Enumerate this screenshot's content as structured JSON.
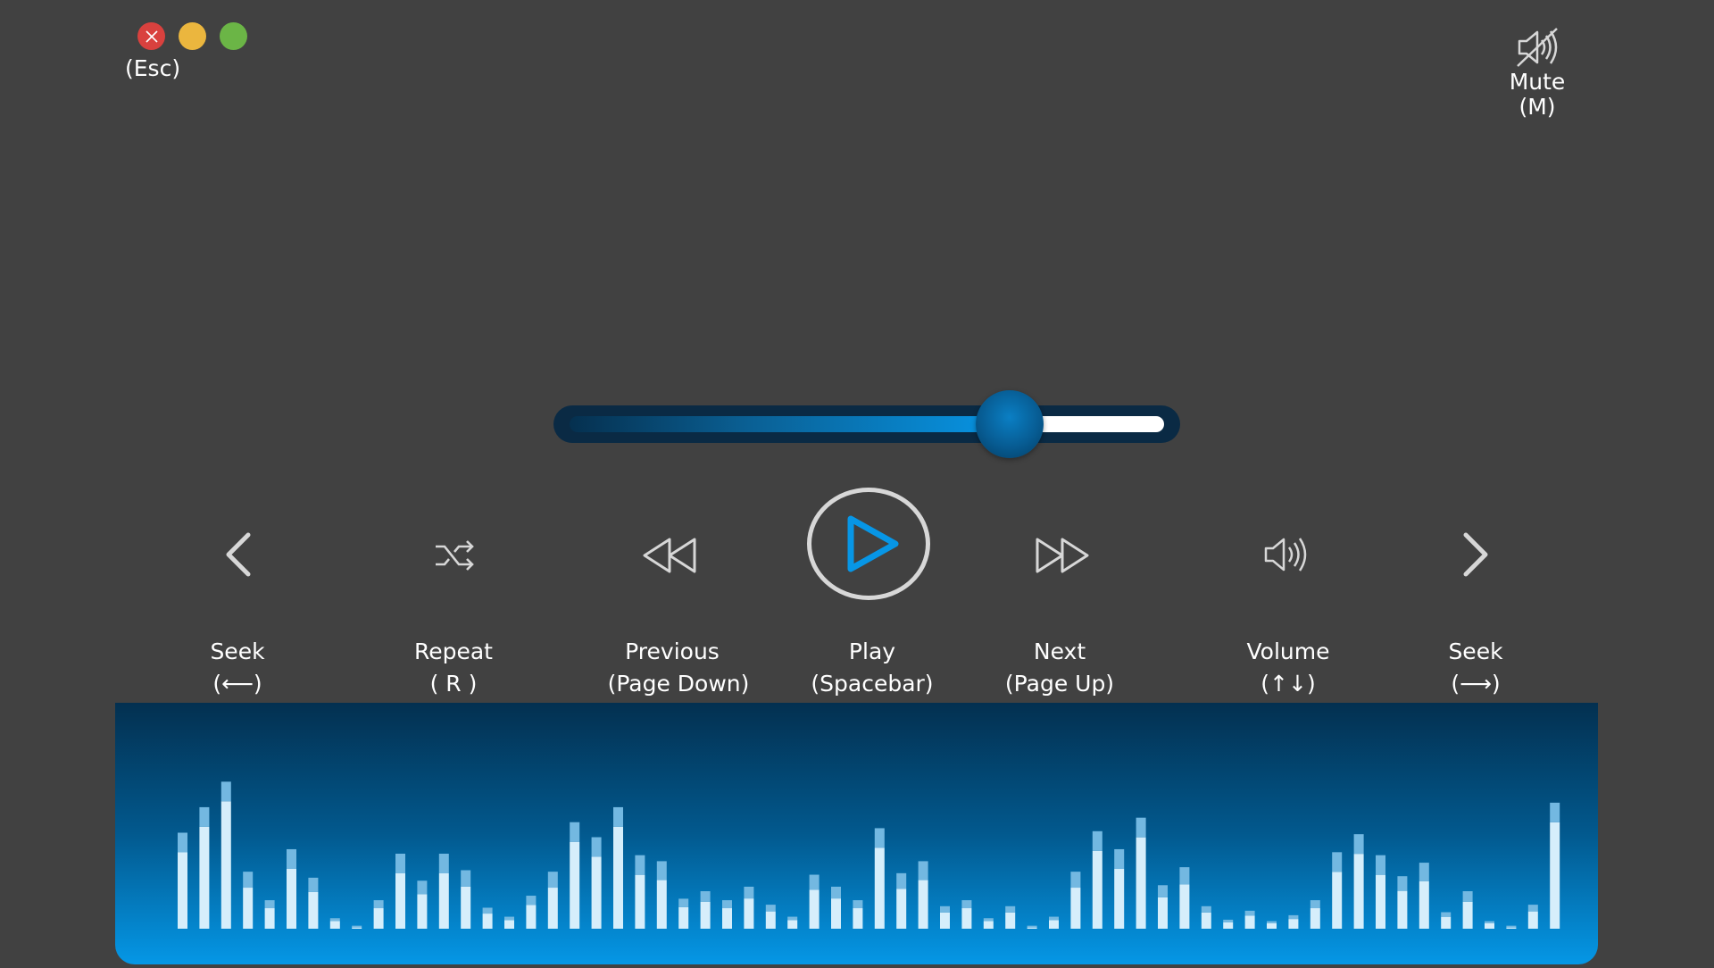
{
  "window_controls": {
    "close": {
      "icon": "close-icon",
      "color": "#d9413e"
    },
    "minimize": {
      "color": "#ebb63e"
    },
    "maximize": {
      "color": "#6bb546"
    },
    "close_hint": "(Esc)"
  },
  "mute": {
    "icon": "speaker-muted-icon",
    "label": "Mute",
    "hint": "(M)"
  },
  "progress": {
    "value": 0.74,
    "accent": "#0796e6"
  },
  "controls": [
    {
      "id": "seek-back",
      "icon": "chevron-left-icon",
      "label": "Seek",
      "hint": "(⟵)"
    },
    {
      "id": "repeat",
      "icon": "shuffle-icon",
      "label": "Repeat",
      "hint": "( R )"
    },
    {
      "id": "previous",
      "icon": "rewind-icon",
      "label": "Previous",
      "hint": "(Page Down)"
    },
    {
      "id": "play",
      "icon": "play-icon",
      "label": "Play",
      "hint": "(Spacebar)"
    },
    {
      "id": "next",
      "icon": "fast-forward-icon",
      "label": "Next",
      "hint": "(Page Up)"
    },
    {
      "id": "volume",
      "icon": "speaker-icon",
      "label": "Volume",
      "hint": "(↑↓)"
    },
    {
      "id": "seek-forward",
      "icon": "chevron-right-icon",
      "label": "Seek",
      "hint": "(⟶)"
    }
  ],
  "equalizer": {
    "levels": [
      0.64,
      0.81,
      0.98,
      0.38,
      0.19,
      0.53,
      0.34,
      0.07,
      0.02,
      0.19,
      0.5,
      0.32,
      0.5,
      0.39,
      0.14,
      0.08,
      0.22,
      0.38,
      0.71,
      0.61,
      0.81,
      0.49,
      0.45,
      0.2,
      0.25,
      0.19,
      0.28,
      0.16,
      0.08,
      0.36,
      0.28,
      0.19,
      0.67,
      0.37,
      0.45,
      0.15,
      0.19,
      0.07,
      0.15,
      0.02,
      0.08,
      0.38,
      0.65,
      0.53,
      0.74,
      0.29,
      0.41,
      0.15,
      0.06,
      0.12,
      0.05,
      0.09,
      0.19,
      0.51,
      0.63,
      0.49,
      0.35,
      0.44,
      0.11,
      0.25,
      0.05,
      0.02,
      0.16,
      0.84
    ],
    "top_color": "#73b8e1",
    "bottom_color": "#d6eefb"
  }
}
